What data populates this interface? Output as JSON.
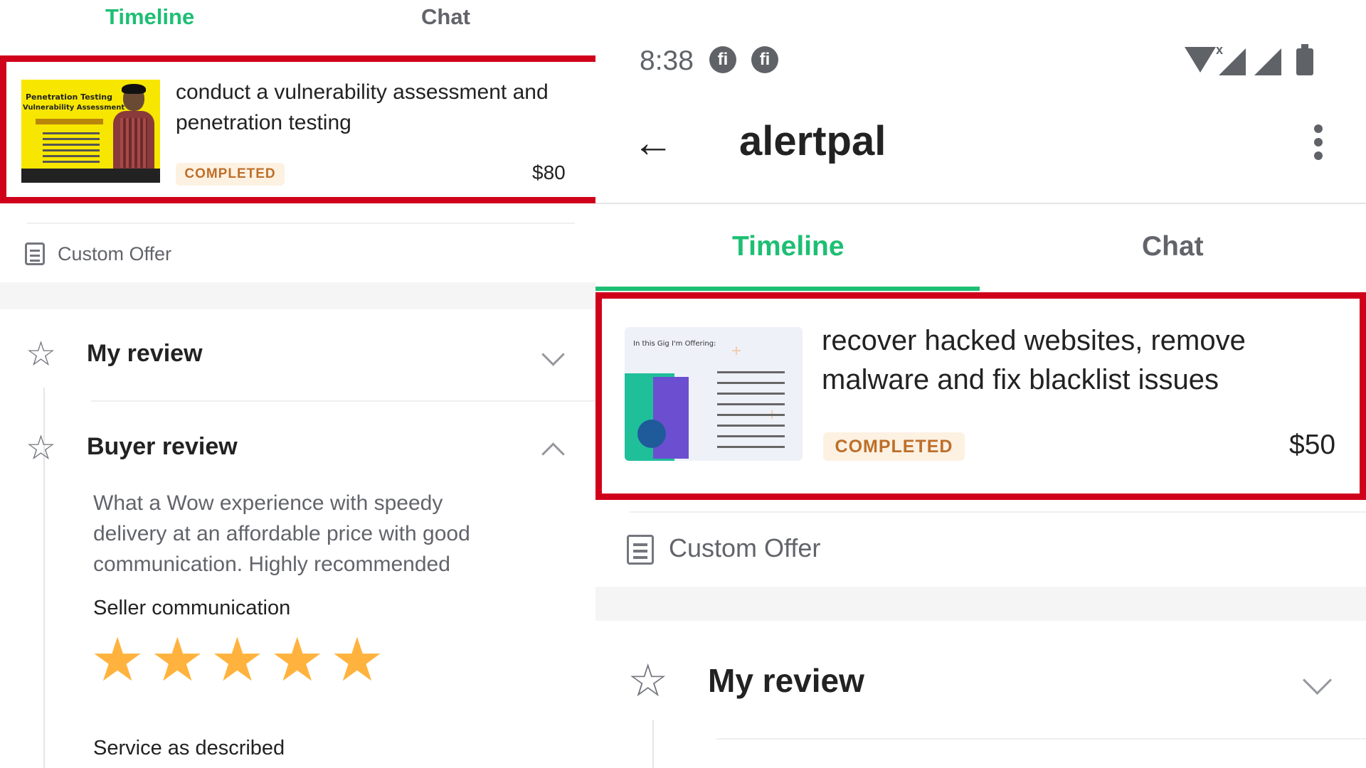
{
  "left": {
    "tabs": {
      "timeline": "Timeline",
      "chat": "Chat"
    },
    "gig": {
      "title": "conduct a vulnerability assessment and penetration testing",
      "status": "COMPLETED",
      "price": "$80",
      "thumbnail_text_1": "Penetration Testing",
      "thumbnail_text_2": "Vulnerability Assessment"
    },
    "custom_offer": "Custom Offer",
    "my_review": "My review",
    "buyer_review": "Buyer review",
    "review_text": "What a Wow experience with speedy delivery at an affordable price with good communication. Highly recommended",
    "seller_communication": "Seller communication",
    "seller_communication_rating": 5,
    "service_as_described": "Service as described"
  },
  "right": {
    "status_bar": {
      "time": "8:38",
      "notification_glyph": "fi"
    },
    "appbar": {
      "title": "alertpal"
    },
    "tabs": {
      "timeline": "Timeline",
      "chat": "Chat"
    },
    "gig": {
      "title": "recover hacked websites, remove malware and fix blacklist issues",
      "status": "COMPLETED",
      "price": "$50",
      "thumbnail_text": "In this Gig I'm Offering:"
    },
    "custom_offer": "Custom Offer",
    "my_review": "My review"
  },
  "colors": {
    "accent_green": "#1dbf73",
    "highlight_red": "#d0021b",
    "badge_bg": "#fdf1e2",
    "badge_text": "#bd6f2a",
    "star_gold": "#ffb33e"
  },
  "icons": {
    "back": "arrow-left-icon",
    "more": "more-vertical-icon",
    "document": "custom-offer-doc-icon",
    "star_outline": "star-outline-icon",
    "star_filled": "star-filled-icon",
    "chevron": "chevron-icon"
  }
}
